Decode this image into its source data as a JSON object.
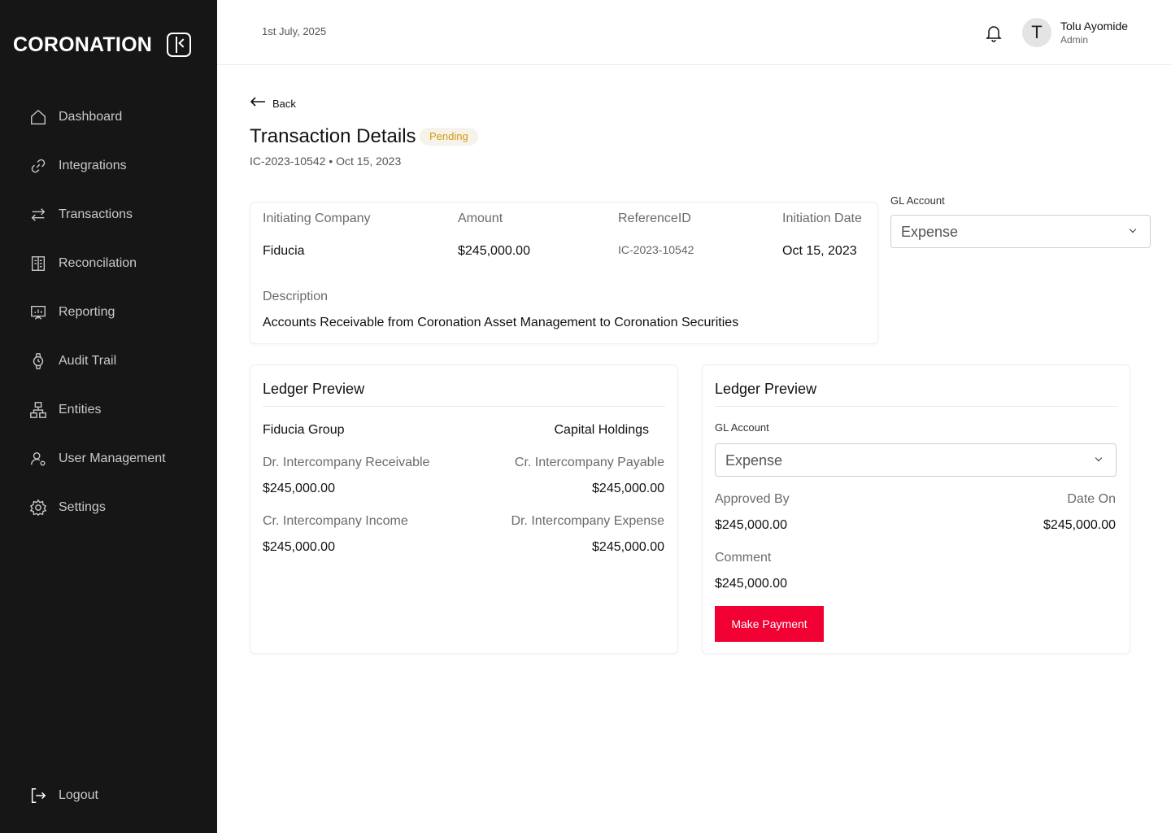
{
  "brand": {
    "logo_text": "CORONATION"
  },
  "sidebar": {
    "items": [
      {
        "label": "Dashboard",
        "icon": "home-icon"
      },
      {
        "label": "Integrations",
        "icon": "link-icon"
      },
      {
        "label": "Transactions",
        "icon": "arrows-swap-icon"
      },
      {
        "label": "Reconcilation",
        "icon": "ledger-book-icon"
      },
      {
        "label": "Reporting",
        "icon": "presentation-chart-icon"
      },
      {
        "label": "Audit Trail",
        "icon": "watch-icon"
      },
      {
        "label": "Entities",
        "icon": "hierarchy-icon"
      },
      {
        "label": "User Management",
        "icon": "user-gear-icon"
      },
      {
        "label": "Settings",
        "icon": "gear-icon"
      }
    ],
    "logout_label": "Logout"
  },
  "header": {
    "date": "1st July, 2025",
    "user": {
      "initial": "T",
      "name": "Tolu Ayomide",
      "role": "Admin"
    }
  },
  "page": {
    "back_label": "Back",
    "title": "Transaction Details",
    "status": "Pending",
    "subtitle": "IC-2023-10542 • Oct 15, 2023"
  },
  "details": {
    "initiating_company_label": "Initiating Company",
    "initiating_company": "Fiducia",
    "amount_label": "Amount",
    "amount": "$245,000.00",
    "reference_label": "ReferenceID",
    "reference": "IC-2023-10542",
    "initiation_date_label": "Initiation Date",
    "initiation_date": "Oct 15, 2023",
    "description_label": "Description",
    "description": "Accounts Receivable from Coronation Asset Management to Coronation Securities"
  },
  "gl_top": {
    "label": "GL Account",
    "value": "Expense"
  },
  "ledger_left": {
    "title": "Ledger Preview",
    "left_entity": "Fiducia Group",
    "right_entity": "Capital Holdings",
    "rows": [
      {
        "left_label": "Dr. Intercompany Receivable",
        "left_value": "$245,000.00",
        "right_label": "Cr. Intercompany Payable",
        "right_value": "$245,000.00"
      },
      {
        "left_label": "Cr. Intercompany Income",
        "left_value": "$245,000.00",
        "right_label": "Dr. Intercompany Expense",
        "right_value": "$245,000.00"
      }
    ]
  },
  "ledger_right": {
    "title": "Ledger Preview",
    "gl_label": "GL Account",
    "gl_value": "Expense",
    "approved_by_label": "Approved By",
    "approved_by": "$245,000.00",
    "date_on_label": "Date On",
    "date_on": "$245,000.00",
    "comment_label": "Comment",
    "comment": "$245,000.00",
    "pay_button": "Make Payment"
  },
  "colors": {
    "sidebar_bg": "#161616",
    "accent_red": "#f00033",
    "pending": "#d49a12"
  }
}
